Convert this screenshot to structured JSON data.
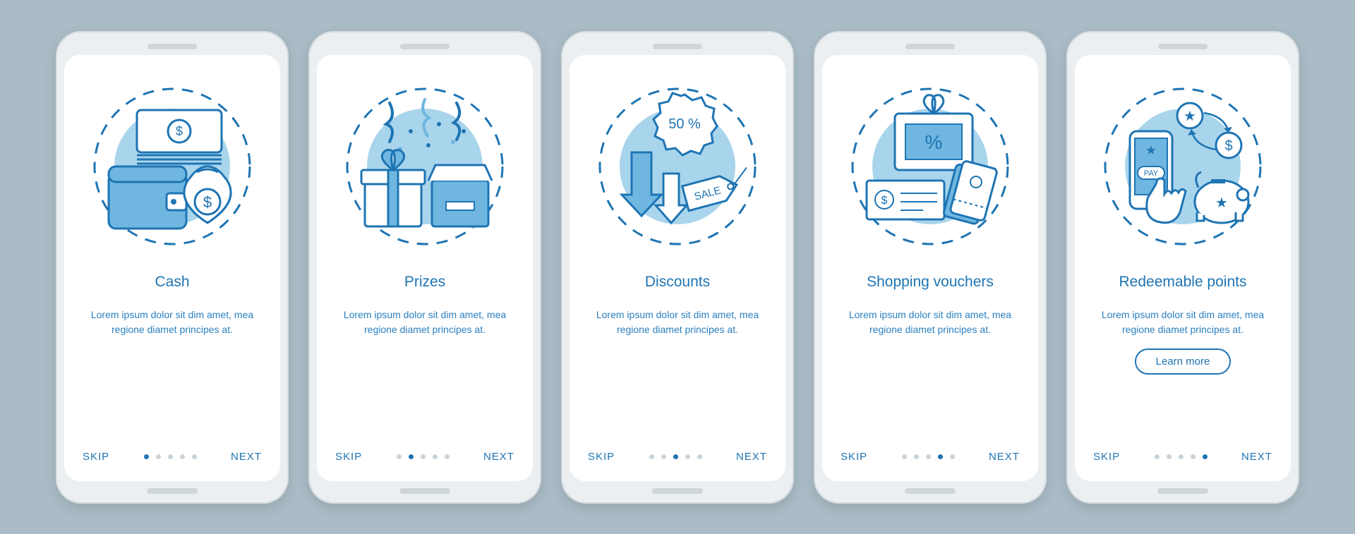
{
  "colors": {
    "accent": "#1e74b3",
    "accent_light": "#6fb7e0",
    "accent_fill": "#a9d5ec",
    "bg": "#aabcc6",
    "phone": "#eceff1",
    "screen": "#ffffff",
    "dot_inactive": "#c9d3da"
  },
  "common": {
    "skip_label": "SKIP",
    "next_label": "NEXT",
    "learn_more_label": "Learn more",
    "description": "Lorem ipsum dolor sit dim amet, mea regione diamet principes at.",
    "total_steps": 5
  },
  "screens": [
    {
      "id": "cash",
      "title": "Cash",
      "icon_name": "cash-wallet-icon",
      "badge_text": null,
      "step_index": 0,
      "show_learn_more": false
    },
    {
      "id": "prizes",
      "title": "Prizes",
      "icon_name": "prizes-gift-icon",
      "badge_text": null,
      "step_index": 1,
      "show_learn_more": false
    },
    {
      "id": "discounts",
      "title": "Discounts",
      "icon_name": "discounts-sale-icon",
      "badge_text": "50 %",
      "tag_text": "SALE",
      "step_index": 2,
      "show_learn_more": false
    },
    {
      "id": "shopping-vouchers",
      "title": "Shopping vouchers",
      "icon_name": "vouchers-tickets-icon",
      "badge_text": null,
      "step_index": 3,
      "show_learn_more": false
    },
    {
      "id": "redeemable-points",
      "title": "Redeemable points",
      "icon_name": "redeemable-points-icon",
      "pay_label": "PAY",
      "step_index": 4,
      "show_learn_more": true
    }
  ]
}
